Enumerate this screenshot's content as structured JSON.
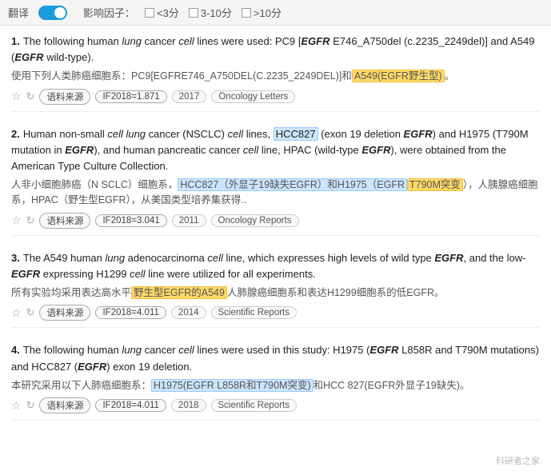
{
  "topbar": {
    "translate_label": "翻译",
    "toggle_on": true,
    "impact_factor_label": "影响因子：",
    "filters": [
      {
        "label": "<3分",
        "checked": false
      },
      {
        "label": "3-10分",
        "checked": false
      },
      {
        "label": ">10分",
        "checked": false
      }
    ]
  },
  "results": [
    {
      "number": "1.",
      "en_text_parts": [
        "The following human ",
        "lung",
        " cancer ",
        "cell",
        " lines were used: PC9 [",
        "EGFR",
        " E746_A750del (c.2235_2249del)] and A549 (",
        "EGFR",
        " wild-type)."
      ],
      "cn_text": "使用下列人类肺癌细胞系：PC9[EGFRE746_A750DEL(C.2235_2249DEL)]和",
      "cn_highlight": "A549(EGFR野生型)。",
      "source_label": "语料来源",
      "if_label": "IF2018=1.871",
      "year_label": "2017",
      "journal_label": "Oncology Letters"
    },
    {
      "number": "2.",
      "en_text_parts": [
        "Human non-small ",
        "cell lung",
        " cancer (NSCLC) ",
        "cell",
        " lines, ",
        "HCC827",
        " (exon 19 deletion ",
        "EGF",
        "R) and H1975 (T790M mutation in ",
        "EGFR",
        "), and human pancreatic cancer ",
        "cell",
        " line, HPAC (wild-type ",
        "EGFR",
        "), were obtained from the American Type Culture Collection."
      ],
      "cn_text": "人非小细胞肺癌（N SCLC）细胞系，",
      "cn_highlight1": "HCC827（外显子19缺失EGFR）和H1975（EGFR",
      "cn_highlight2": "T790M突变），人胰腺癌细胞系，HPAC（野生型EGFR），从美国类型培养集获得..",
      "source_label": "语料来源",
      "if_label": "IF2018=3.041",
      "year_label": "2011",
      "journal_label": "Oncology Reports"
    },
    {
      "number": "3.",
      "en_text_parts": [
        "The A549 human ",
        "lung",
        " adenocarcinoma ",
        "cell",
        " line, which expresses high levels of wild type ",
        "EGFR",
        ", and the low-",
        "EGFR",
        " expressing H1299 ",
        "cell",
        " line were utilized for all experiments."
      ],
      "cn_text": "所有实验均采用表达高水平",
      "cn_highlight": "野生型EGFR的A549",
      "cn_text2": "人肺腺癌细胞系和表达H1299细胞系的低EGFR。",
      "source_label": "语料来源",
      "if_label": "IF2018=4.011",
      "year_label": "2014",
      "journal_label": "Scientific Reports"
    },
    {
      "number": "4.",
      "en_text_parts": [
        "The following human ",
        "lung",
        " cancer ",
        "cell",
        " lines were used in this study: H1975 (",
        "EGFR",
        " L858R and T790M mutations) and HCC827 (",
        "EGFR",
        ") exon 19 deletion."
      ],
      "cn_text": "本研究采用以下人肺癌细胞系：",
      "cn_highlight": "H1975(EGFR L858R和T790M突变)",
      "cn_text2": "和HCC 827(EGFR外显子19缺失)。",
      "source_label": "语料来源",
      "if_label": "IF2018=4.011",
      "year_label": "2018",
      "journal_label": "Scientific Reports"
    }
  ],
  "watermark": "科研者之家"
}
